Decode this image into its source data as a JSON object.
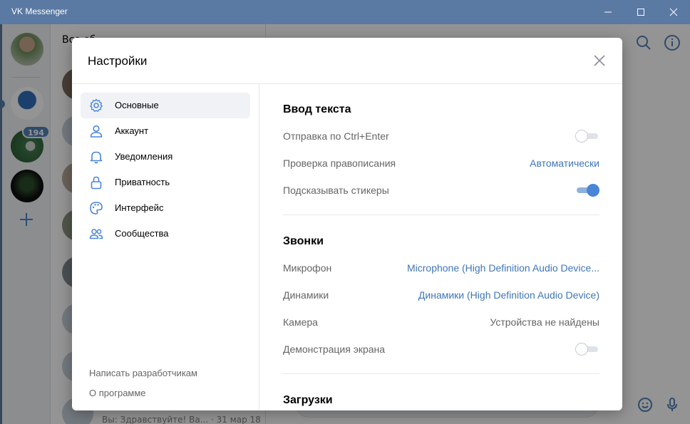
{
  "window": {
    "title": "VK Messenger"
  },
  "background": {
    "rail_badge": "194",
    "list_header": "Все  об",
    "list_last_message": "Вы: Здравствуйте! Ва... · 31 мар 18"
  },
  "settings": {
    "title": "Настройки",
    "menu": [
      {
        "label": "Основные",
        "icon": "gear-icon",
        "active": true
      },
      {
        "label": "Аккаунт",
        "icon": "person-icon",
        "active": false
      },
      {
        "label": "Уведомления",
        "icon": "bell-icon",
        "active": false
      },
      {
        "label": "Приватность",
        "icon": "lock-icon",
        "active": false
      },
      {
        "label": "Интерфейс",
        "icon": "palette-icon",
        "active": false
      },
      {
        "label": "Сообщества",
        "icon": "people-icon",
        "active": false
      }
    ],
    "footer": {
      "write_devs": "Написать разработчикам",
      "about": "О программе"
    },
    "sections": {
      "text_input": {
        "title": "Ввод текста",
        "ctrl_enter": {
          "label": "Отправка по Ctrl+Enter",
          "enabled": false
        },
        "spellcheck": {
          "label": "Проверка правописания",
          "value": "Автоматически"
        },
        "sticker_hints": {
          "label": "Подсказывать стикеры",
          "enabled": true
        }
      },
      "calls": {
        "title": "Звонки",
        "microphone": {
          "label": "Микрофон",
          "value": "Microphone (High Definition Audio Device..."
        },
        "speakers": {
          "label": "Динамики",
          "value": "Динамики (High Definition Audio Device)"
        },
        "camera": {
          "label": "Камера",
          "value": "Устройства не найдены"
        },
        "screen_share": {
          "label": "Демонстрация экрана",
          "enabled": false
        }
      },
      "downloads": {
        "title": "Загрузки"
      }
    }
  },
  "colors": {
    "titlebar": "#5a79a3",
    "accent": "#4a86d8",
    "link": "#3f76b8"
  }
}
